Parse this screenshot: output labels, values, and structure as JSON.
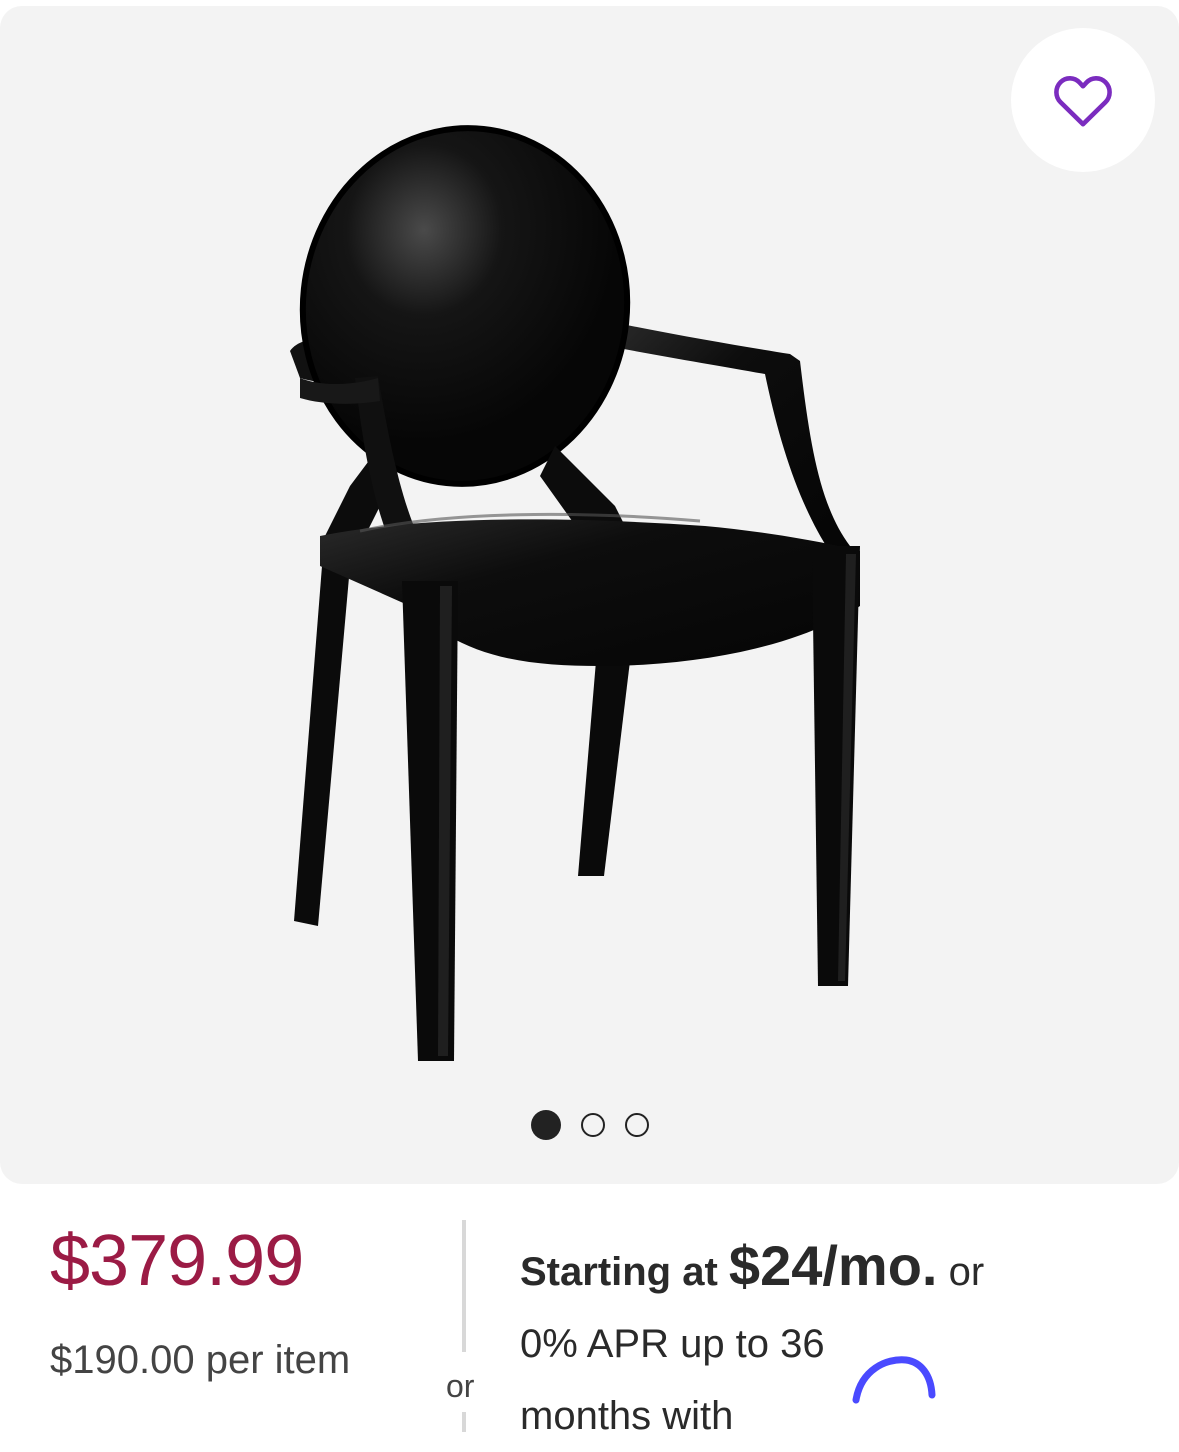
{
  "gallery": {
    "image_alt": "Black acrylic ghost-style armchair",
    "slide_count": 3,
    "active_slide": 1,
    "favorite_icon": "heart-outline-icon",
    "favorite_color": "#7b2cbf"
  },
  "pricing": {
    "price": "$379.99",
    "unit_price": "$190.00 per item",
    "price_color": "#9b1b45",
    "divider_label": "or"
  },
  "financing": {
    "lead": "Starting at",
    "amount": "$24/mo.",
    "or": "or",
    "line2": "0% APR up to 36",
    "line3_partial": "months with",
    "provider_icon": "affirm-logo-icon"
  }
}
